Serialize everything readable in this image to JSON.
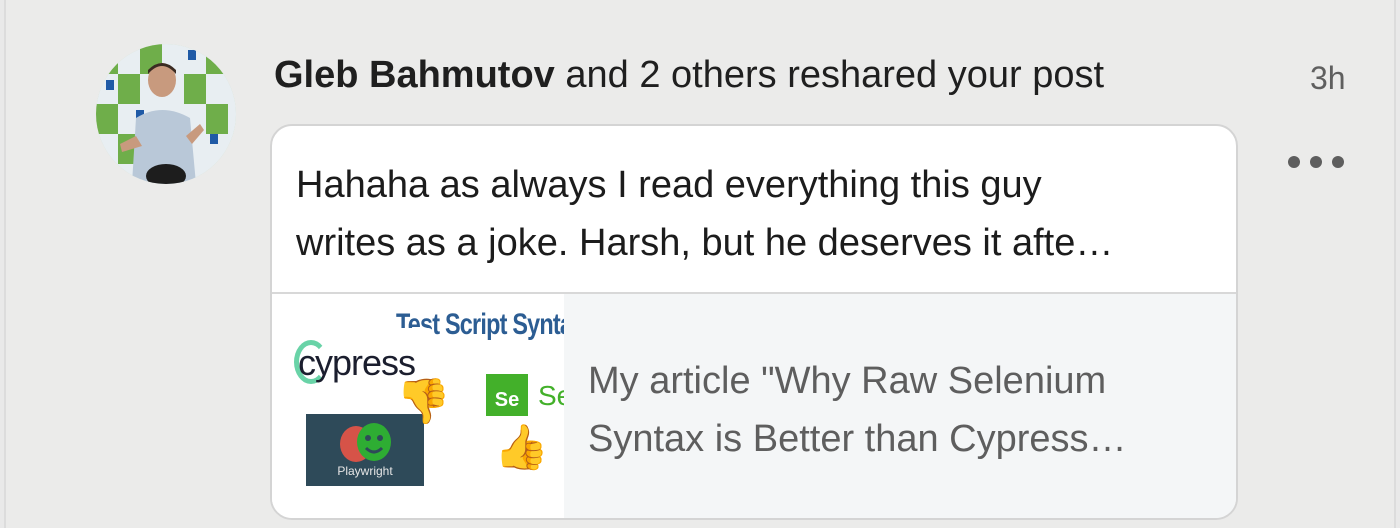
{
  "notification": {
    "actor_name": "Gleb Bahmutov",
    "action_text": " and 2 others reshared your post",
    "timestamp": "3h"
  },
  "card": {
    "comment_line_1": "Hahaha as always I read everything this guy",
    "comment_line_2": "writes as a joke. Harsh, but he deserves it afte…",
    "shared_article": {
      "title_line_1": "My article \"Why Raw Selenium",
      "title_line_2": "Syntax is Better than Cypress…",
      "thumbnail": {
        "heading": "Test Script Syntax",
        "cypress_label": "cypress",
        "playwright_label": "Playwright",
        "selenium_badge": "Se",
        "selenium_label": "Se",
        "thumbs_down": "👎",
        "thumbs_up": "👍"
      }
    }
  },
  "icons": {
    "more": "more-horizontal-icon"
  },
  "colors": {
    "background": "#ebebea",
    "card_background": "#ffffff",
    "article_background": "#f4f6f7",
    "text_primary": "#1f1f1f",
    "text_secondary": "#5e5e5e"
  }
}
